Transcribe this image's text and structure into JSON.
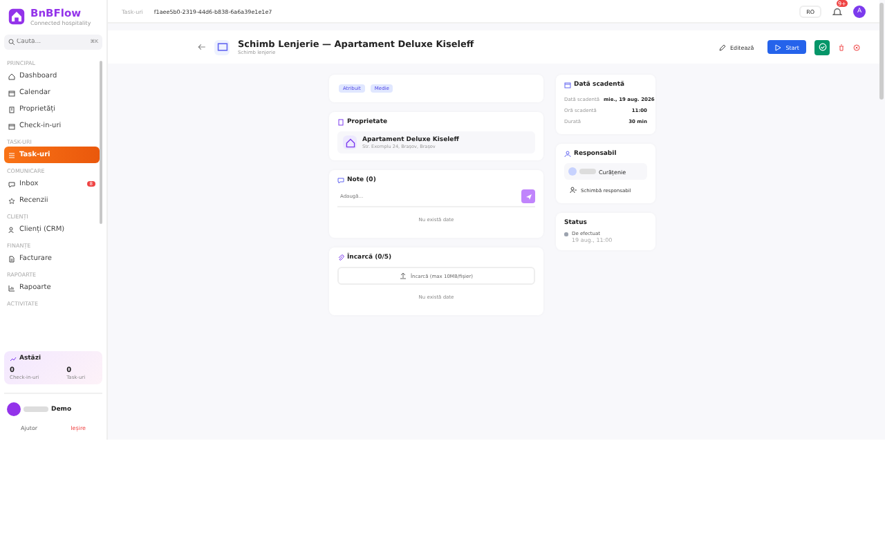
{
  "brand": {
    "name": "BnBFlow",
    "tagline": "Connected hospitality"
  },
  "search": {
    "placeholder": "Caută...",
    "shortcut": "⌘K"
  },
  "nav": [
    {
      "heading": "PRINCIPAL",
      "items": [
        {
          "label": "Dashboard",
          "selected": false
        },
        {
          "label": "Calendar",
          "selected": false
        },
        {
          "label": "Proprietăți",
          "selected": false
        },
        {
          "label": "Check-in-uri",
          "selected": false
        }
      ]
    },
    {
      "heading": "TASK-URI",
      "items": [
        {
          "label": "Task-uri",
          "selected": true
        }
      ]
    },
    {
      "heading": "COMUNICARE",
      "items": [
        {
          "label": "Inbox",
          "selected": false,
          "badge": "8"
        },
        {
          "label": "Recenzii",
          "selected": false
        }
      ]
    },
    {
      "heading": "CLIENȚI",
      "items": [
        {
          "label": "Clienți (CRM)",
          "selected": false
        }
      ]
    },
    {
      "heading": "FINANȚE",
      "items": [
        {
          "label": "Facturare",
          "selected": false
        }
      ]
    },
    {
      "heading": "RAPOARTE",
      "items": [
        {
          "label": "Rapoarte",
          "selected": false
        }
      ]
    }
  ],
  "nav_more": "ACTIVITATE",
  "today": {
    "title": "Astăzi",
    "stats": [
      {
        "value": "0",
        "label": "Check-in-uri"
      },
      {
        "value": "0",
        "label": "Task-uri"
      }
    ]
  },
  "user": {
    "name": "Demo"
  },
  "footer": {
    "help": "Ajutor",
    "logout": "Ieșire"
  },
  "breadcrumb": {
    "parent": "Task-uri",
    "current": "f1aee5b0-2319-44d6-b838-6a6a39e1e1e7"
  },
  "topbar": {
    "language": "RO",
    "notifications": "9+",
    "avatar": "A"
  },
  "task": {
    "title": "Schimb Lenjerie — Apartament Deluxe Kiseleff",
    "subtitle": "Schimb lenjerie",
    "actions": {
      "edit": "Editează",
      "start": "Start"
    },
    "tags": [
      "Atribuit",
      "Medie"
    ]
  },
  "property": {
    "heading": "Proprietate",
    "name": "Apartament Deluxe Kiseleff",
    "address": "Str. Exemplu 24, Brașov, Brașov"
  },
  "notes": {
    "heading": "Note (0)",
    "placeholder": "Adaugă...",
    "empty": "Nu există date"
  },
  "uploads": {
    "heading": "Încarcă (0/5)",
    "button": "Încarcă (max 10MB/fișier)",
    "empty": "Nu există date"
  },
  "due": {
    "heading": "Dată scadentă",
    "rows": [
      {
        "label": "Dată scadentă",
        "value": "mie., 19 aug. 2026"
      },
      {
        "label": "Oră scadentă",
        "value": "11:00"
      },
      {
        "label": "Durată",
        "value": "30 min"
      }
    ]
  },
  "responsible": {
    "heading": "Responsabil",
    "team": "Curățenie",
    "change": "Schimbă responsabil"
  },
  "status": {
    "heading": "Status",
    "entries": [
      {
        "label": "De efectuat",
        "time": "19 aug., 11:00",
        "color": "#9ca3af"
      }
    ]
  }
}
